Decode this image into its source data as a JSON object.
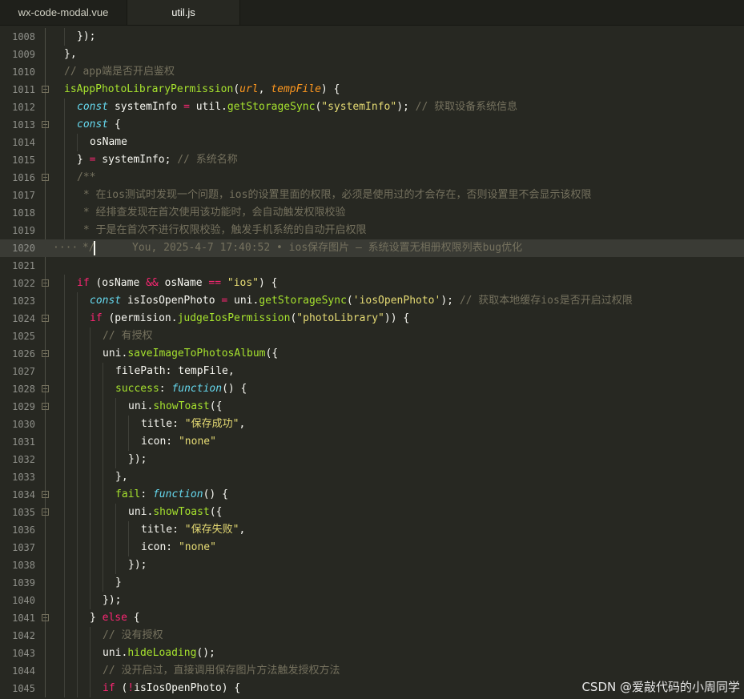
{
  "tabs": [
    {
      "label": "wx-code-modal.vue",
      "active": false
    },
    {
      "label": "util.js",
      "active": true
    }
  ],
  "editor": {
    "active_line": "1020",
    "folded_lines": [
      "1011",
      "1013",
      "1016",
      "1022",
      "1024",
      "1026",
      "1028",
      "1029",
      "1034",
      "1035",
      "1041"
    ],
    "lines": [
      {
        "n": "1008",
        "indent": 1,
        "tokens": [
          [
            "w",
            "});"
          ]
        ]
      },
      {
        "n": "1009",
        "indent": 0,
        "tokens": [
          [
            "w",
            "},"
          ]
        ]
      },
      {
        "n": "1010",
        "indent": 0,
        "tokens": [
          [
            "c",
            "// app端是否开启鉴权"
          ]
        ]
      },
      {
        "n": "1011",
        "indent": 0,
        "tokens": [
          [
            "f",
            "isAppPhotoLibraryPermission"
          ],
          [
            "w",
            "("
          ],
          [
            "p",
            "url"
          ],
          [
            "w",
            ", "
          ],
          [
            "p",
            "tempFile"
          ],
          [
            "w",
            ") {"
          ]
        ]
      },
      {
        "n": "1012",
        "indent": 1,
        "tokens": [
          [
            "st",
            "const"
          ],
          [
            "w",
            " systemInfo "
          ],
          [
            "k",
            "="
          ],
          [
            "w",
            " util."
          ],
          [
            "f",
            "getStorageSync"
          ],
          [
            "w",
            "("
          ],
          [
            "s",
            "\"systemInfo\""
          ],
          [
            "w",
            "); "
          ],
          [
            "c",
            "// 获取设备系统信息"
          ]
        ]
      },
      {
        "n": "1013",
        "indent": 1,
        "tokens": [
          [
            "st",
            "const"
          ],
          [
            "w",
            " {"
          ]
        ]
      },
      {
        "n": "1014",
        "indent": 2,
        "tokens": [
          [
            "w",
            "osName"
          ]
        ]
      },
      {
        "n": "1015",
        "indent": 1,
        "tokens": [
          [
            "w",
            "} "
          ],
          [
            "k",
            "="
          ],
          [
            "w",
            " systemInfo; "
          ],
          [
            "c",
            "// 系统名称"
          ]
        ]
      },
      {
        "n": "1016",
        "indent": 1,
        "tokens": [
          [
            "c",
            "/**"
          ]
        ]
      },
      {
        "n": "1017",
        "indent": 1,
        "tokens": [
          [
            "c",
            " * 在ios测试时发现一个问题，ios的设置里面的权限，必须是使用过的才会存在，否则设置里不会显示该权限"
          ]
        ]
      },
      {
        "n": "1018",
        "indent": 1,
        "tokens": [
          [
            "c",
            " * 经排查发现在首次使用该功能时，会自动触发权限校验"
          ]
        ]
      },
      {
        "n": "1019",
        "indent": 1,
        "tokens": [
          [
            "c",
            " * 于是在首次不进行权限校验，触发手机系统的自动开启权限"
          ]
        ]
      },
      {
        "n": "1020",
        "indent": 0,
        "dots": "····",
        "tokens": [
          [
            "c",
            " */"
          ]
        ],
        "blame": "You, 2025-4-7 17:40:52 • ios保存图片 – 系统设置无相册权限列表bug优化"
      },
      {
        "n": "1021",
        "indent": 0,
        "tokens": []
      },
      {
        "n": "1022",
        "indent": 1,
        "tokens": [
          [
            "k",
            "if"
          ],
          [
            "w",
            " (osName "
          ],
          [
            "k",
            "&&"
          ],
          [
            "w",
            " osName "
          ],
          [
            "k",
            "=="
          ],
          [
            "w",
            " "
          ],
          [
            "s",
            "\"ios\""
          ],
          [
            "w",
            ") {"
          ]
        ]
      },
      {
        "n": "1023",
        "indent": 2,
        "tokens": [
          [
            "st",
            "const"
          ],
          [
            "w",
            " isIosOpenPhoto "
          ],
          [
            "k",
            "="
          ],
          [
            "w",
            " uni."
          ],
          [
            "f",
            "getStorageSync"
          ],
          [
            "w",
            "("
          ],
          [
            "s",
            "'iosOpenPhoto'"
          ],
          [
            "w",
            "); "
          ],
          [
            "c",
            "// 获取本地缓存ios是否开启过权限"
          ]
        ]
      },
      {
        "n": "1024",
        "indent": 2,
        "tokens": [
          [
            "k",
            "if"
          ],
          [
            "w",
            " (permision."
          ],
          [
            "f",
            "judgeIosPermission"
          ],
          [
            "w",
            "("
          ],
          [
            "s",
            "\"photoLibrary\""
          ],
          [
            "w",
            ")) {"
          ]
        ]
      },
      {
        "n": "1025",
        "indent": 3,
        "tokens": [
          [
            "c",
            "// 有授权"
          ]
        ]
      },
      {
        "n": "1026",
        "indent": 3,
        "tokens": [
          [
            "w",
            "uni."
          ],
          [
            "f",
            "saveImageToPhotosAlbum"
          ],
          [
            "w",
            "({"
          ]
        ]
      },
      {
        "n": "1027",
        "indent": 4,
        "tokens": [
          [
            "w",
            "filePath: tempFile,"
          ]
        ]
      },
      {
        "n": "1028",
        "indent": 4,
        "tokens": [
          [
            "f",
            "success"
          ],
          [
            "w",
            ": "
          ],
          [
            "st",
            "function"
          ],
          [
            "w",
            "() {"
          ]
        ]
      },
      {
        "n": "1029",
        "indent": 5,
        "tokens": [
          [
            "w",
            "uni."
          ],
          [
            "f",
            "showToast"
          ],
          [
            "w",
            "({"
          ]
        ]
      },
      {
        "n": "1030",
        "indent": 6,
        "tokens": [
          [
            "w",
            "title: "
          ],
          [
            "s",
            "\"保存成功\""
          ],
          [
            "w",
            ","
          ]
        ]
      },
      {
        "n": "1031",
        "indent": 6,
        "tokens": [
          [
            "w",
            "icon: "
          ],
          [
            "s",
            "\"none\""
          ]
        ]
      },
      {
        "n": "1032",
        "indent": 5,
        "tokens": [
          [
            "w",
            "});"
          ]
        ]
      },
      {
        "n": "1033",
        "indent": 4,
        "tokens": [
          [
            "w",
            "},"
          ]
        ]
      },
      {
        "n": "1034",
        "indent": 4,
        "tokens": [
          [
            "f",
            "fail"
          ],
          [
            "w",
            ": "
          ],
          [
            "st",
            "function"
          ],
          [
            "w",
            "() {"
          ]
        ]
      },
      {
        "n": "1035",
        "indent": 5,
        "tokens": [
          [
            "w",
            "uni."
          ],
          [
            "f",
            "showToast"
          ],
          [
            "w",
            "({"
          ]
        ]
      },
      {
        "n": "1036",
        "indent": 6,
        "tokens": [
          [
            "w",
            "title: "
          ],
          [
            "s",
            "\"保存失败\""
          ],
          [
            "w",
            ","
          ]
        ]
      },
      {
        "n": "1037",
        "indent": 6,
        "tokens": [
          [
            "w",
            "icon: "
          ],
          [
            "s",
            "\"none\""
          ]
        ]
      },
      {
        "n": "1038",
        "indent": 5,
        "tokens": [
          [
            "w",
            "});"
          ]
        ]
      },
      {
        "n": "1039",
        "indent": 4,
        "tokens": [
          [
            "w",
            "}"
          ]
        ]
      },
      {
        "n": "1040",
        "indent": 3,
        "tokens": [
          [
            "w",
            "});"
          ]
        ]
      },
      {
        "n": "1041",
        "indent": 2,
        "tokens": [
          [
            "w",
            "} "
          ],
          [
            "k",
            "else"
          ],
          [
            "w",
            " {"
          ]
        ]
      },
      {
        "n": "1042",
        "indent": 3,
        "tokens": [
          [
            "c",
            "// 没有授权"
          ]
        ]
      },
      {
        "n": "1043",
        "indent": 3,
        "tokens": [
          [
            "w",
            "uni."
          ],
          [
            "f",
            "hideLoading"
          ],
          [
            "w",
            "();"
          ]
        ]
      },
      {
        "n": "1044",
        "indent": 3,
        "tokens": [
          [
            "c",
            "// 没开启过，直接调用保存图片方法触发授权方法"
          ]
        ]
      },
      {
        "n": "1045",
        "indent": 3,
        "tokens": [
          [
            "k",
            "if"
          ],
          [
            "w",
            " ("
          ],
          [
            "k",
            "!"
          ],
          [
            "w",
            "isIosOpenPhoto) {"
          ]
        ]
      }
    ]
  },
  "watermark": "CSDN @爱敲代码的小周同学"
}
